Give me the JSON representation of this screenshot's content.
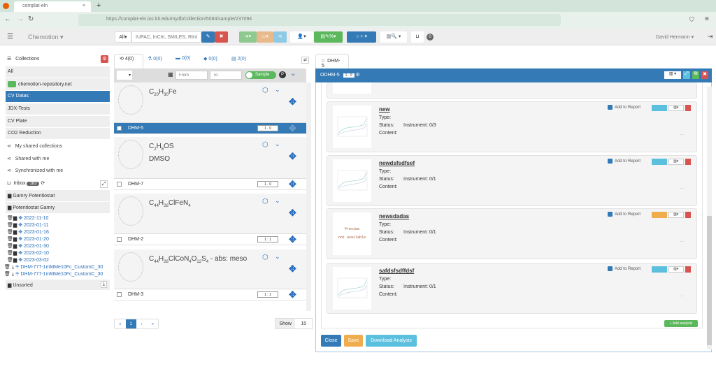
{
  "browser": {
    "tab_title": "complat-eln",
    "url": "https://complat-eln.ioc.kit.edu/mydb/collection/5084/sample/237094"
  },
  "navbar": {
    "brand": "Chemotion",
    "search_scope": "All",
    "search_placeholder": "IUPAC, InChI, SMILES, RInChI",
    "user": "David Hermann",
    "notif_count": "0"
  },
  "sidebar": {
    "header": "Collections",
    "collections": [
      {
        "label": "All"
      },
      {
        "label": "chemotion-repository.net"
      },
      {
        "label": "CV Datas",
        "active": true
      },
      {
        "label": "JDX-Tests"
      },
      {
        "label": "CV Plate"
      },
      {
        "label": "CO2 Reduction"
      }
    ],
    "links": [
      "My shared collections",
      "Shared with me",
      "Synchronized with me"
    ],
    "inbox": {
      "label": "Inbox",
      "count": "183"
    },
    "inbox_folders": [
      "Gamry Potentiostat",
      "Potentiostat Gamry"
    ],
    "tree": [
      "2022-11-10",
      "2023-01-11",
      "2023-01-16",
      "2023-01-20",
      "2023-01-30",
      "2023-02-10",
      "2023-03-02"
    ],
    "files": [
      "DHM-777-1mMMe10Fc_CustomC_30",
      "DHM-777-1mMMe10Fc_CustomC_30"
    ],
    "unsorted": "Unsorted"
  },
  "list": {
    "tabs": [
      "4(0)",
      "0(0)",
      "0(0)",
      "0(0)",
      "2(0)"
    ],
    "from_placeholder": "From",
    "to_placeholder": "To",
    "toggle_label": "Sample",
    "samples": [
      {
        "formula_html": "C<sub>20</sub>H<sub>30</sub>Fe",
        "name": "",
        "label": "DHM-5",
        "badge": "1 · 0",
        "selected": true
      },
      {
        "formula_html": "C<sub>2</sub>H<sub>6</sub>OS",
        "name": "DMSO",
        "label": "DHM-7",
        "badge": "1 · 0",
        "selected": false
      },
      {
        "formula_html": "C<sub>44</sub>H<sub>28</sub>ClFeN<sub>4</sub>",
        "name": "",
        "label": "DHM-2",
        "badge": "1 : 1",
        "selected": false
      },
      {
        "formula_html": "C<sub>44</sub>H<sub>28</sub>ClCoN<sub>4</sub>O<sub>12</sub>S<sub>4</sub> - abs: meso",
        "name": "",
        "label": "DHM-3",
        "badge": "1 : 1",
        "selected": false
      }
    ],
    "pagination": {
      "current": "1",
      "first": "«",
      "prev": "‹",
      "next": "›",
      "last": "»"
    },
    "show_label": "Show",
    "per_page": "15"
  },
  "detail": {
    "tab_label": "DHM-5",
    "title": "ODHM-5",
    "badge": "1 · 0",
    "labels": {
      "type": "Type:",
      "status": "Status:",
      "content": "Content:",
      "add_report": "Add to Report",
      "preview_na_1": "Preview",
      "preview_na_2": "not available",
      "dots": "..."
    },
    "analyses": [
      {
        "name": "new",
        "instrument": "Instrument: 0/3",
        "preview": true,
        "color": "#5bc0de"
      },
      {
        "name": "newdsfsdfsef",
        "instrument": "Instrument: 0/1",
        "preview": true,
        "color": "#5bc0de"
      },
      {
        "name": "newsdadas",
        "instrument": "Instrument: 0/1",
        "preview": false,
        "color": "#f0ad4e"
      },
      {
        "name": "safdsfsdffdsf",
        "instrument": "Instrument: 0/1",
        "preview": true,
        "color": "#5bc0de"
      }
    ],
    "add_analysis": "+ Add analysis",
    "close": "Close",
    "save": "Save",
    "download": "Download Analysis"
  },
  "colors": {
    "primary": "#337ab7",
    "danger": "#d9534f",
    "success": "#5cb85c",
    "warning": "#f0ad4e",
    "info": "#5bc0de"
  }
}
